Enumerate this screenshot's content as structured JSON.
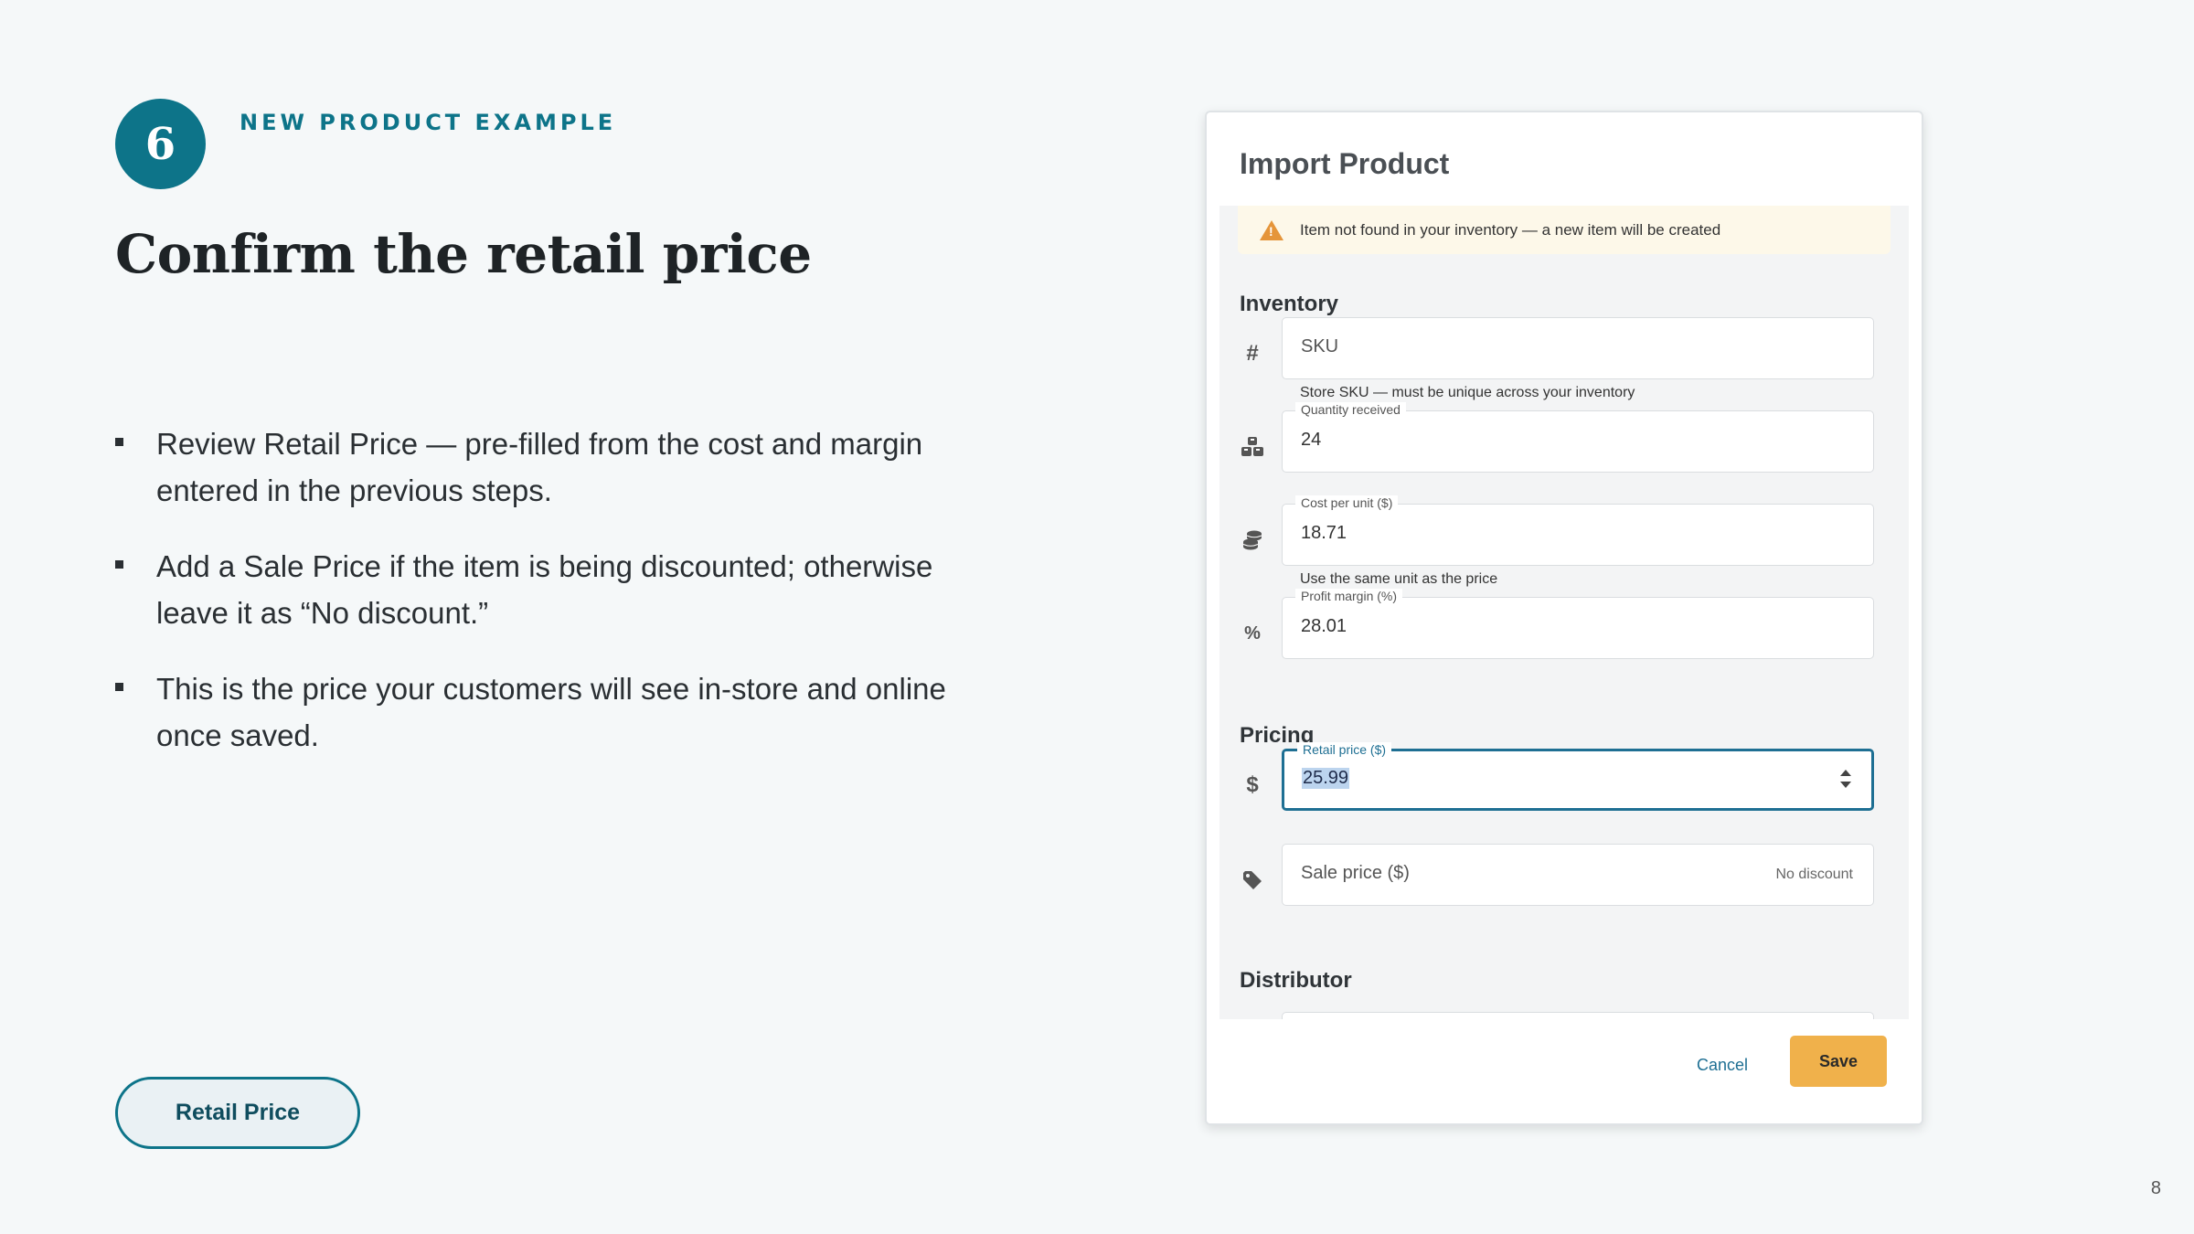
{
  "slide": {
    "step_number": "6",
    "eyebrow": "NEW PRODUCT EXAMPLE",
    "title": "Confirm the retail price",
    "bullets": [
      "Review Retail Price — pre-filled from the cost and margin entered in the previous steps.",
      "Add a Sale Price if the item is being discounted; otherwise leave it as “No discount.”",
      "This is the price your customers will see in-store and online once saved."
    ],
    "pill_label": "Retail Price",
    "page_number": "8"
  },
  "dialog": {
    "title": "Import Product",
    "warning": "Item not found in your inventory — a new item will be created",
    "sections": {
      "inventory": "Inventory",
      "pricing": "Pricing",
      "distributor": "Distributor"
    },
    "fields": {
      "sku": {
        "placeholder": "SKU",
        "helper": "Store SKU — must be unique across your inventory"
      },
      "quantity": {
        "label": "Quantity received",
        "value": "24"
      },
      "cost": {
        "label": "Cost per unit ($)",
        "value": "18.71",
        "helper": "Use the same unit as the price"
      },
      "margin": {
        "label": "Profit margin (%)",
        "value": "28.01"
      },
      "retail": {
        "label": "Retail price ($)",
        "value": "25.99"
      },
      "sale": {
        "placeholder": "Sale price ($)",
        "adornment": "No discount"
      }
    },
    "buttons": {
      "cancel": "Cancel",
      "save": "Save"
    }
  },
  "colors": {
    "accent_teal": "#0d7489",
    "save_button": "#f0b14b",
    "warning_icon": "#e5953a",
    "active_border": "#1e6f93"
  },
  "icons": {
    "sku": "hash-icon",
    "quantity": "boxes-icon",
    "cost": "coins-icon",
    "margin": "percent-icon",
    "retail": "dollar-icon",
    "sale": "tag-icon",
    "warning": "warning-icon"
  }
}
